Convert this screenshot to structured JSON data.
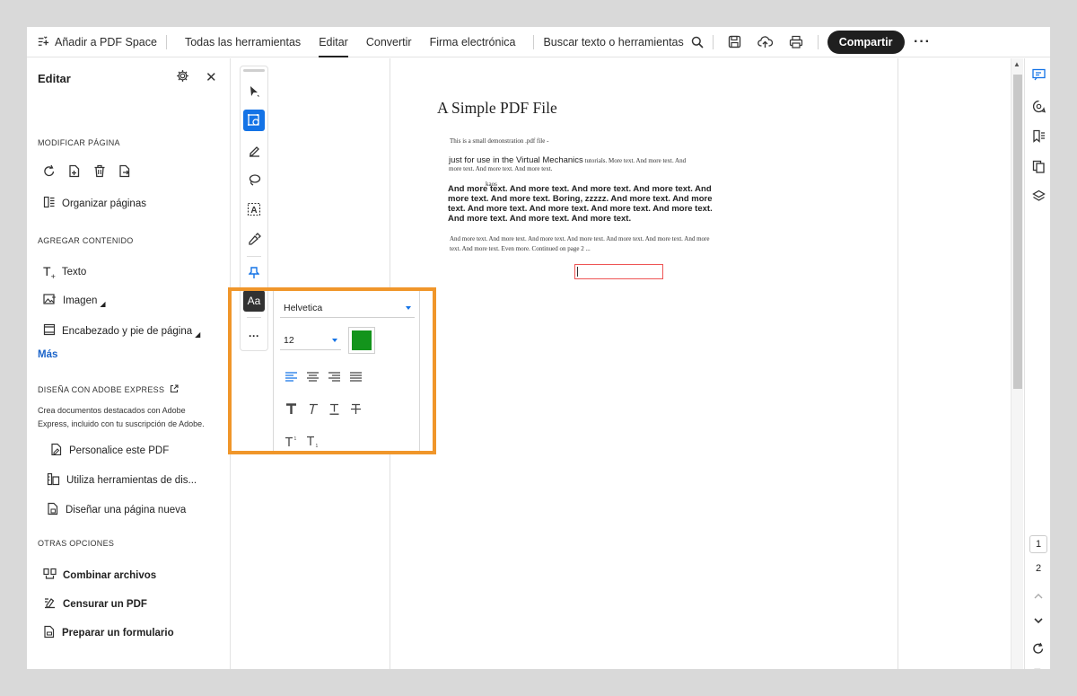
{
  "colors": {
    "accent": "#1473e6",
    "highlight": "#f0962a",
    "text_color_swatch": "#13941c",
    "share_bg": "#1f1f1f",
    "link": "#1a63c9",
    "textbox_border": "#ee5555"
  },
  "topbar": {
    "add_space_label": "Añadir a PDF Space",
    "tabs": [
      "Todas las herramientas",
      "Editar",
      "Convertir",
      "Firma electrónica"
    ],
    "active_tab": "Editar",
    "search_label": "Buscar texto o herramientas",
    "share_label": "Compartir"
  },
  "leftpanel": {
    "title": "Editar",
    "sections": {
      "modify_page": "MODIFICAR PÁGINA",
      "add_content": "AGREGAR CONTENIDO",
      "design": "DISEÑA CON ADOBE EXPRESS",
      "other": "OTRAS OPCIONES"
    },
    "organize_pages": "Organizar páginas",
    "add_items": [
      "Texto",
      "Imagen",
      "Encabezado y pie de página"
    ],
    "more": "Más",
    "design_desc": "Crea documentos destacados con Adobe Express, incluido con tu suscripción de Adobe.",
    "design_items": [
      "Personalice este PDF",
      "Utiliza herramientas de dis...",
      "Diseñar una página nueva"
    ],
    "other_items": [
      "Combinar archivos",
      "Censurar un PDF",
      "Preparar un formulario"
    ]
  },
  "toolstrip": {
    "text_style_label": "Aa",
    "more": "···"
  },
  "document": {
    "title": "A Simple PDF File",
    "line1": "This is a small demonstration .pdf file -",
    "line2_sans": "just for use in the Virtual Mechanics",
    "line2_serif": " tutorials. More text. And more  text. And",
    "line3": "more text. And more text. And more text.",
    "kaos": "kaos",
    "bold_para": "And more text. And more text. And more text. And more text. And more  text. And more text. Boring, zzzzz. And more text. And more text. And  more text. And more text. And more text. And more text. And more text.  And more text. And more text.",
    "line4": "And more text. And more text. And more text. And more text. And more  text. And more text. And more",
    "line5": "text. And more text. Even more. Continued on page 2 ..."
  },
  "format_panel": {
    "font": "Helvetica",
    "size": "12"
  },
  "pagenav": {
    "pages": [
      "1",
      "2"
    ],
    "current": "1"
  }
}
